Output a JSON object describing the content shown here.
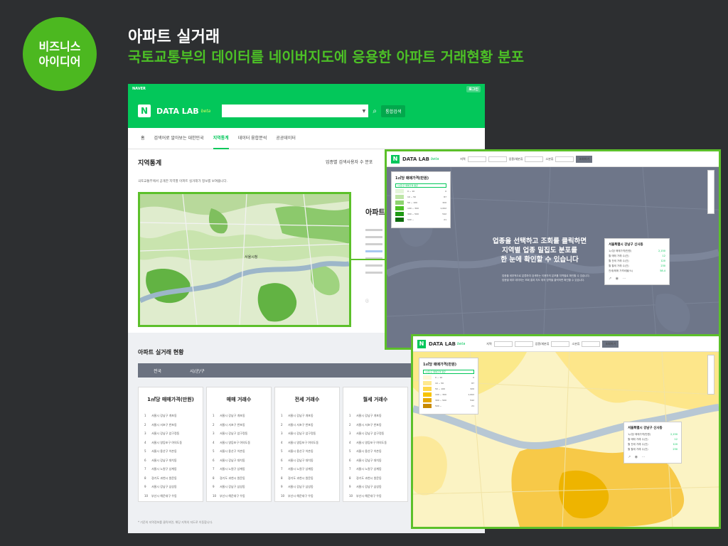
{
  "slide": {
    "badge_line1": "비즈니스",
    "badge_line2": "아이디어",
    "title": "아파트 실거래",
    "subtitle": "국토교통부의 데이터를 네이버지도에 응용한 아파트 거래현황 분포"
  },
  "page": {
    "naver_label": "NAVER",
    "login_label": "로그인",
    "logo_letter": "N",
    "logo_text": "DATA LAB",
    "logo_beta": "beta",
    "integrated_search": "통합검색",
    "nav": [
      "홈",
      "검색어로 알아보는 대한민국",
      "지역통계",
      "데이터 융합분석",
      "공공데이터"
    ],
    "region_title": "지역통계",
    "region_right": "업종별 검색사용자 수 분포",
    "region_desc": "국토교통부에서 공개한 지역별 아파트 실거래가 정보를 보여줍니다.",
    "map_label": "서울시청",
    "side_title": "아파트",
    "trade_title": "아파트 실거래 현황",
    "filter_country": "전국",
    "filter_city": "시/군/구",
    "foot_note": "* 기준의 지역정보를 클릭하면, 해당 지역의 지도로 이동합니다.",
    "rank_cards": [
      {
        "title": "1㎡당 매매가격(만원)",
        "rows": [
          "서울시 강남구 개포동",
          "서울시 서초구 반포동",
          "서울시 강남구 압구정동",
          "서울시 영등포구 여의도동",
          "서울시 용산구 이촌동",
          "서울시 강남구 대치동",
          "서울시 노원구 상계동",
          "경기도 과천시 원문동",
          "서울시 강남구 삼성동",
          "부산시 해운대구 우동"
        ]
      },
      {
        "title": "매매 거래수",
        "rows": [
          "서울시 강남구 개포동",
          "서울시 서초구 반포동",
          "서울시 강남구 압구정동",
          "서울시 영등포구 여의도동",
          "서울시 용산구 이촌동",
          "서울시 강남구 대치동",
          "서울시 노원구 상계동",
          "경기도 과천시 원문동",
          "서울시 강남구 삼성동",
          "부산시 해운대구 우동"
        ]
      },
      {
        "title": "전세 거래수",
        "rows": [
          "서울시 강남구 개포동",
          "서울시 서초구 반포동",
          "서울시 강남구 압구정동",
          "서울시 영등포구 여의도동",
          "서울시 용산구 이촌동",
          "서울시 강남구 대치동",
          "서울시 노원구 상계동",
          "경기도 과천시 원문동",
          "서울시 강남구 삼성동",
          "부산시 해운대구 우동"
        ]
      },
      {
        "title": "월세 거래수",
        "rows": [
          "서울시 강남구 개포동",
          "서울시 서초구 반포동",
          "서울시 강남구 압구정동",
          "서울시 영등포구 여의도동",
          "서울시 용산구 이촌동",
          "서울시 강남구 대치동",
          "서울시 노원구 상계동",
          "경기도 과천시 원문동",
          "서울시 강남구 삼성동",
          "부산시 해운대구 우동"
        ]
      }
    ]
  },
  "win1": {
    "filters": [
      "지역",
      "서울",
      "업종/세분류",
      "전체",
      "소분류",
      "전체"
    ],
    "search": "조회하기",
    "legend_title": "1㎡당 매매가격(만원)",
    "legend_select": "시/군/구 매매가격 평균",
    "legend_rows": [
      {
        "label": "0 ~ 10",
        "count": "0",
        "color": "#e4f5da"
      },
      {
        "label": "10 ~ 50",
        "count": "87",
        "color": "#bfe6a8"
      },
      {
        "label": "50 ~ 100",
        "count": "320",
        "color": "#8ed470"
      },
      {
        "label": "100 ~ 300",
        "count": "1,002",
        "color": "#4cc026"
      },
      {
        "label": "300 ~ 500",
        "count": "542",
        "color": "#1f9a14"
      },
      {
        "label": "500 ~",
        "count": "21",
        "color": "#0e6b0c"
      }
    ],
    "overlay_line1": "업종을 선택하고 조회를 클릭하면",
    "overlay_line2": "지역별 업종 밀집도 분포를",
    "overlay_line3": "한 눈에 확인할 수 있습니다",
    "overlay_note1": "업종을 세부적으로 분류하여 검색하는 이용자의 분포를 지역별로 확인할 수 있습니다.",
    "overlay_note2": "업종별 세부 데이터는 조회 결과 지도 위의 영역을 클릭하면 확인할 수 있습니다.",
    "overlay_close": "오늘 하루 그만보기",
    "popup_title": "서울특별시 강남구 신사동",
    "popup_rows": [
      {
        "k": "1㎡당 매매가격(만원)",
        "v": "2,150"
      },
      {
        "k": "월 매매 거래 수(건)",
        "v": "12"
      },
      {
        "k": "월 전세 거래 수(건)",
        "v": "120"
      },
      {
        "k": "월 월세 거래 수(건)",
        "v": "230"
      },
      {
        "k": "전세/매매 가격비율(%)",
        "v": "58.4"
      }
    ]
  },
  "win2": {
    "logo_text": "DATA LAB",
    "logo_beta": "beta",
    "filters": [
      "지역",
      "서울",
      "업종/세분류",
      "전체",
      "소분류",
      "전체"
    ],
    "search": "조회하기",
    "legend_title": "1㎡당 매매가격(만원)",
    "legend_select": "시/군/구 매매가격 평균",
    "legend_rows": [
      {
        "label": "0 ~ 10",
        "count": "0",
        "color": "#fff7d6"
      },
      {
        "label": "10 ~ 50",
        "count": "87",
        "color": "#ffe98f"
      },
      {
        "label": "50 ~ 100",
        "count": "320",
        "color": "#ffd84a"
      },
      {
        "label": "100 ~ 300",
        "count": "1,002",
        "color": "#f7c300"
      },
      {
        "label": "300 ~ 500",
        "count": "542",
        "color": "#e6a800"
      },
      {
        "label": "500 ~",
        "count": "21",
        "color": "#c88a00"
      }
    ],
    "popup_title": "서울특별시 강남구 신사동",
    "popup_rows": [
      {
        "k": "1㎡당 매매가격(만원)",
        "v": "2,150"
      },
      {
        "k": "월 매매 거래 수(건)",
        "v": "12"
      },
      {
        "k": "월 전세 거래 수(건)",
        "v": "120"
      },
      {
        "k": "월 월세 거래 수(건)",
        "v": "230"
      }
    ]
  },
  "colors": {
    "naver_green": "#03c75a",
    "accent_green": "#4cc026",
    "slide_bg": "#2d2f31",
    "map_gray": "#6e7689",
    "map_yellow": "#fbe98a"
  }
}
